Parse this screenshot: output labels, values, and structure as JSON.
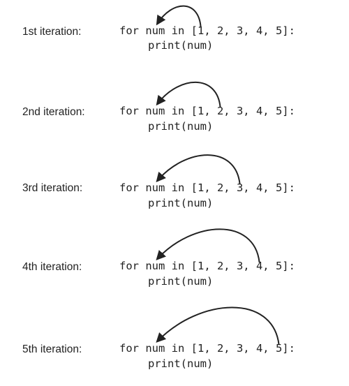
{
  "iterations": [
    {
      "label": "1st iteration:",
      "loop_line": "for num in [1, 2, 3, 4, 5]:",
      "body_line": "print(num)",
      "current_item": 1
    },
    {
      "label": "2nd iteration:",
      "loop_line": "for num in [1, 2, 3, 4, 5]:",
      "body_line": "print(num)",
      "current_item": 2
    },
    {
      "label": "3rd iteration:",
      "loop_line": "for num in [1, 2, 3, 4, 5]:",
      "body_line": "print(num)",
      "current_item": 3
    },
    {
      "label": "4th iteration:",
      "loop_line": "for num in [1, 2, 3, 4, 5]:",
      "body_line": "print(num)",
      "current_item": 4
    },
    {
      "label": "5th iteration:",
      "loop_line": "for num in [1, 2, 3, 4, 5]:",
      "body_line": "print(num)",
      "current_item": 5
    }
  ],
  "colors": {
    "ink": "#222222",
    "background": "#ffffff"
  }
}
